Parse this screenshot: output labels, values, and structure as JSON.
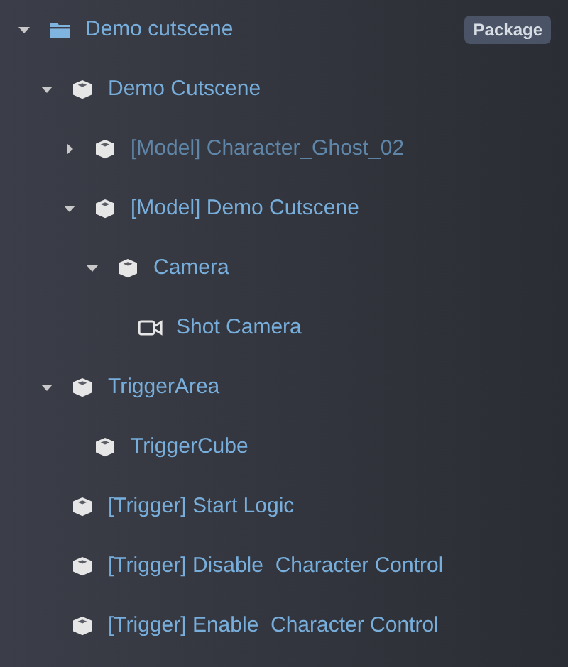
{
  "tree": [
    {
      "label": "Demo cutscene",
      "kind": "folder",
      "expanded": true,
      "dimmed": false,
      "badge": "Package",
      "children": [
        {
          "label": "Demo Cutscene",
          "kind": "object",
          "expanded": true,
          "dimmed": false,
          "children": [
            {
              "label": "[Model] Character_Ghost_02",
              "kind": "object",
              "expanded": false,
              "dimmed": true
            },
            {
              "label": "[Model] Demo Cutscene",
              "kind": "object",
              "expanded": true,
              "dimmed": false,
              "children": [
                {
                  "label": "Camera",
                  "kind": "object",
                  "expanded": true,
                  "dimmed": false,
                  "children": [
                    {
                      "label": "Shot Camera",
                      "kind": "camera",
                      "dimmed": false
                    }
                  ]
                }
              ]
            }
          ]
        },
        {
          "label": "TriggerArea",
          "kind": "object",
          "expanded": true,
          "dimmed": false,
          "children": [
            {
              "label": "TriggerCube",
              "kind": "object",
              "dimmed": false
            }
          ]
        },
        {
          "label": "[Trigger] Start Logic",
          "kind": "object",
          "dimmed": false
        },
        {
          "label": "[Trigger] Disable  Character Control",
          "kind": "object",
          "dimmed": false
        },
        {
          "label": "[Trigger] Enable  Character Control",
          "kind": "object",
          "dimmed": false
        }
      ]
    }
  ]
}
